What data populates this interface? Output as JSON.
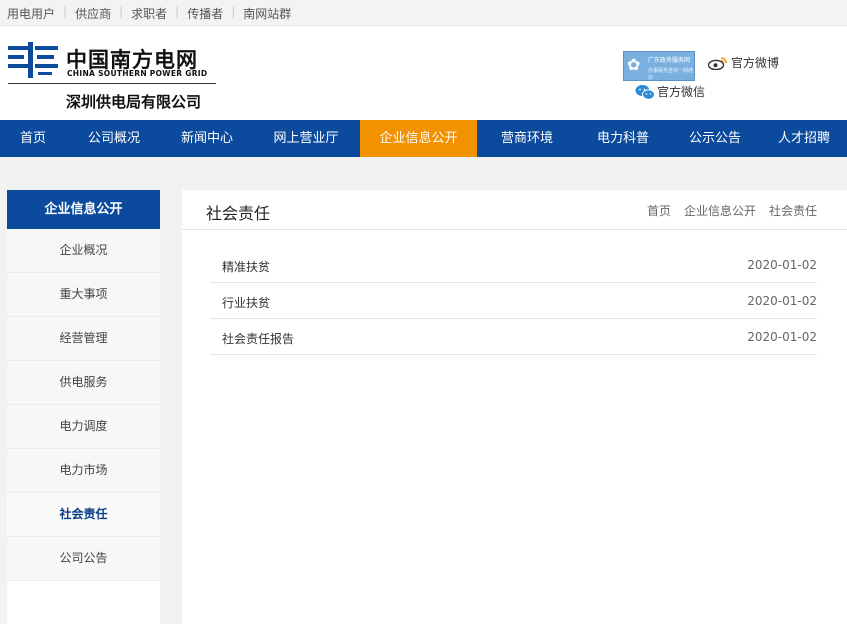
{
  "topbar": {
    "links": [
      "用电用户",
      "供应商",
      "求职者",
      "传播者",
      "南网站群"
    ]
  },
  "header": {
    "logo_cn": "中国南方电网",
    "logo_en": "CHINA SOUTHERN POWER GRID",
    "logo_sub": "深圳供电局有限公司",
    "gov_badge_line1": "广东政务服务网",
    "gov_badge_line2": "办事服务咨询一网通办",
    "weibo_label": "官方微博",
    "wechat_label": "官方微信",
    "colors": {
      "brand_blue": "#0b4a9c",
      "accent_orange": "#f39200"
    }
  },
  "nav": {
    "items": [
      "首页",
      "公司概况",
      "新闻中心",
      "网上营业厅",
      "企业信息公开",
      "营商环境",
      "电力科普",
      "公示公告",
      "人才招聘"
    ],
    "active_index": 4
  },
  "sidebar": {
    "title": "企业信息公开",
    "items": [
      "企业概况",
      "重大事项",
      "经营管理",
      "供电服务",
      "电力调度",
      "电力市场",
      "社会责任",
      "公司公告"
    ],
    "active_index": 6
  },
  "main": {
    "title": "社会责任",
    "breadcrumb": [
      "首页",
      "企业信息公开",
      "社会责任"
    ],
    "rows": [
      {
        "title": "精准扶贫",
        "date": "2020-01-02"
      },
      {
        "title": "行业扶贫",
        "date": "2020-01-02"
      },
      {
        "title": "社会责任报告",
        "date": "2020-01-02"
      }
    ]
  }
}
